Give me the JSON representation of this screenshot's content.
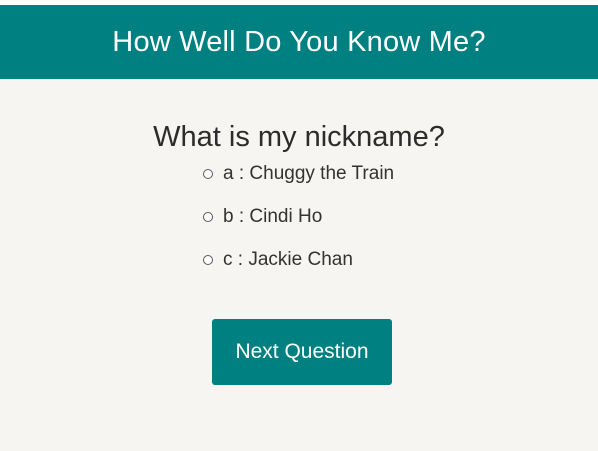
{
  "header": {
    "title": "How Well Do You Know Me?"
  },
  "quiz": {
    "question": "What is my nickname?",
    "answers": [
      {
        "label": "a : Chuggy the Train",
        "selected": false
      },
      {
        "label": "b : Cindi Ho",
        "selected": false
      },
      {
        "label": "c : Jackie Chan",
        "selected": false
      }
    ],
    "next_label": "Next Question"
  },
  "colors": {
    "accent": "#008080",
    "background": "#f6f5f1",
    "text": "#333333"
  }
}
